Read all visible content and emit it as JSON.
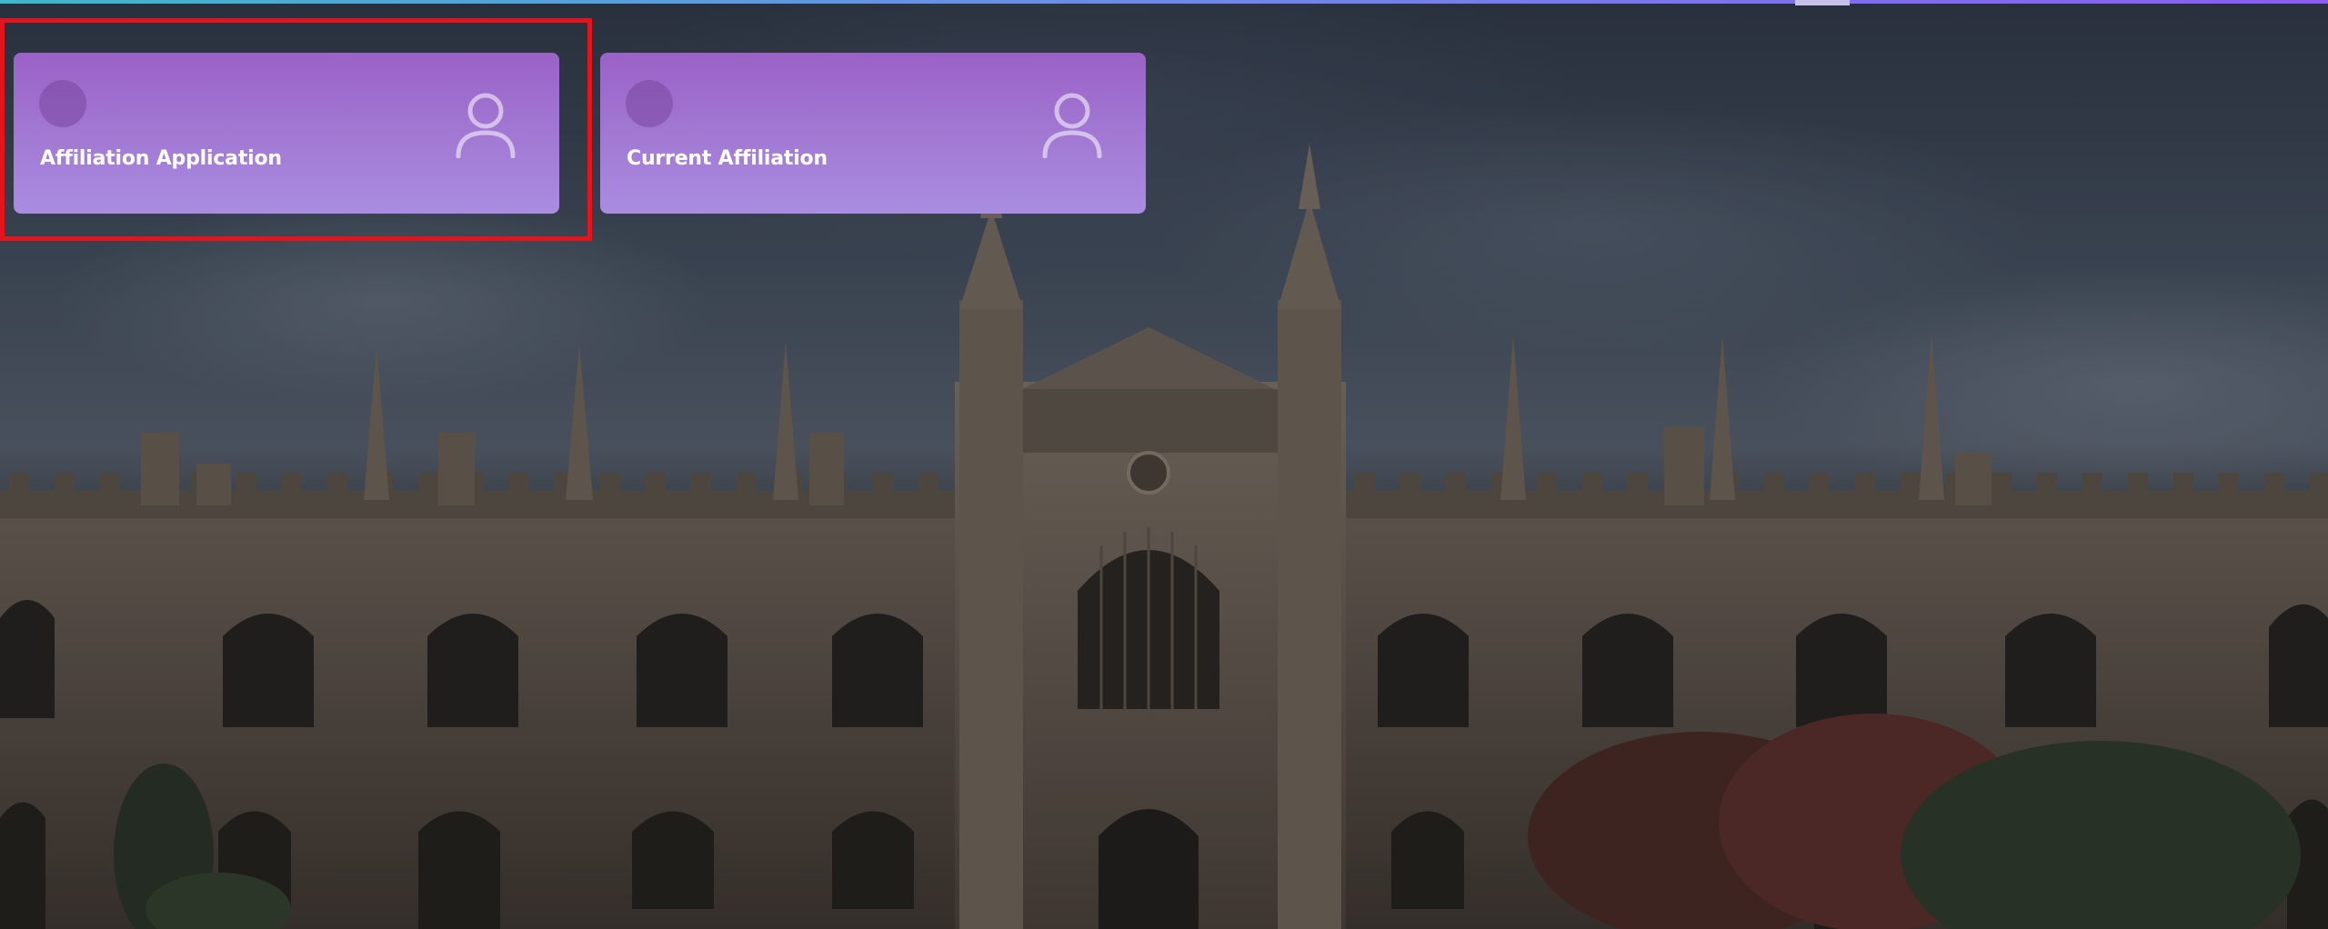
{
  "cards": [
    {
      "label": "Affiliation Application",
      "icon": "user-icon",
      "selected": true
    },
    {
      "label": "Current Affiliation",
      "icon": "user-icon",
      "selected": false
    }
  ],
  "colors": {
    "card_gradient_top": "#9a62c6",
    "card_gradient_bottom": "#a98de0",
    "selection_outline": "#e3141b",
    "top_line_start": "#3fb6c9",
    "top_line_end": "#8a5cf0"
  }
}
